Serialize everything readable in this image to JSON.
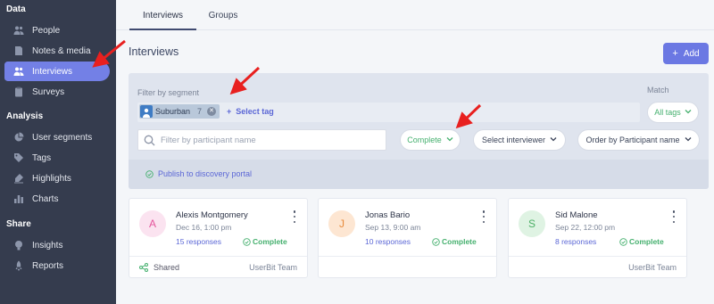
{
  "sidebar": {
    "sections": [
      {
        "title": "Data",
        "items": [
          {
            "label": "People",
            "icon": "people-icon"
          },
          {
            "label": "Notes & media",
            "icon": "notes-icon"
          },
          {
            "label": "Interviews",
            "icon": "interviews-icon",
            "active": true
          },
          {
            "label": "Surveys",
            "icon": "surveys-icon"
          }
        ]
      },
      {
        "title": "Analysis",
        "items": [
          {
            "label": "User segments",
            "icon": "pie-icon"
          },
          {
            "label": "Tags",
            "icon": "tag-icon"
          },
          {
            "label": "Highlights",
            "icon": "highlight-icon"
          },
          {
            "label": "Charts",
            "icon": "chart-icon"
          }
        ]
      },
      {
        "title": "Share",
        "items": [
          {
            "label": "Insights",
            "icon": "insights-icon"
          },
          {
            "label": "Reports",
            "icon": "reports-icon"
          }
        ]
      }
    ]
  },
  "tabs": [
    {
      "label": "Interviews",
      "active": true
    },
    {
      "label": "Groups",
      "active": false
    }
  ],
  "header": {
    "title": "Interviews",
    "add_label": "Add"
  },
  "filters": {
    "segment_label": "Filter by segment",
    "match_label": "Match",
    "chip": {
      "label": "Suburban",
      "count": "7"
    },
    "select_tag": "Select tag",
    "match_value": "All tags",
    "search_placeholder": "Filter by participant name",
    "status_filter": "Complete",
    "interviewer_filter": "Select interviewer",
    "order_filter": "Order by Participant name",
    "publish_link": "Publish to discovery portal"
  },
  "cards": [
    {
      "initial": "A",
      "name": "Alexis Montgomery",
      "date": "Dec 16, 1:00 pm",
      "responses": "15 responses",
      "status": "Complete",
      "shared": "Shared",
      "team": "UserBit Team",
      "avatar_bg": "#fbe3f0",
      "avatar_fg": "#e4559c"
    },
    {
      "initial": "J",
      "name": "Jonas Bario",
      "date": "Sep 13, 9:00 am",
      "responses": "10 responses",
      "status": "Complete",
      "shared": "",
      "team": "",
      "avatar_bg": "#fde6d2",
      "avatar_fg": "#e78a3a"
    },
    {
      "initial": "S",
      "name": "Sid Malone",
      "date": "Sep 22, 12:00 pm",
      "responses": "8 responses",
      "status": "Complete",
      "shared": "",
      "team": "UserBit Team",
      "avatar_bg": "#dff3e3",
      "avatar_fg": "#4caf65"
    }
  ],
  "colors": {
    "accent": "#6b78e3",
    "sidebar": "#353c4e",
    "active": "#7380e6",
    "success": "#45b06e",
    "arrow": "#e8201f"
  }
}
